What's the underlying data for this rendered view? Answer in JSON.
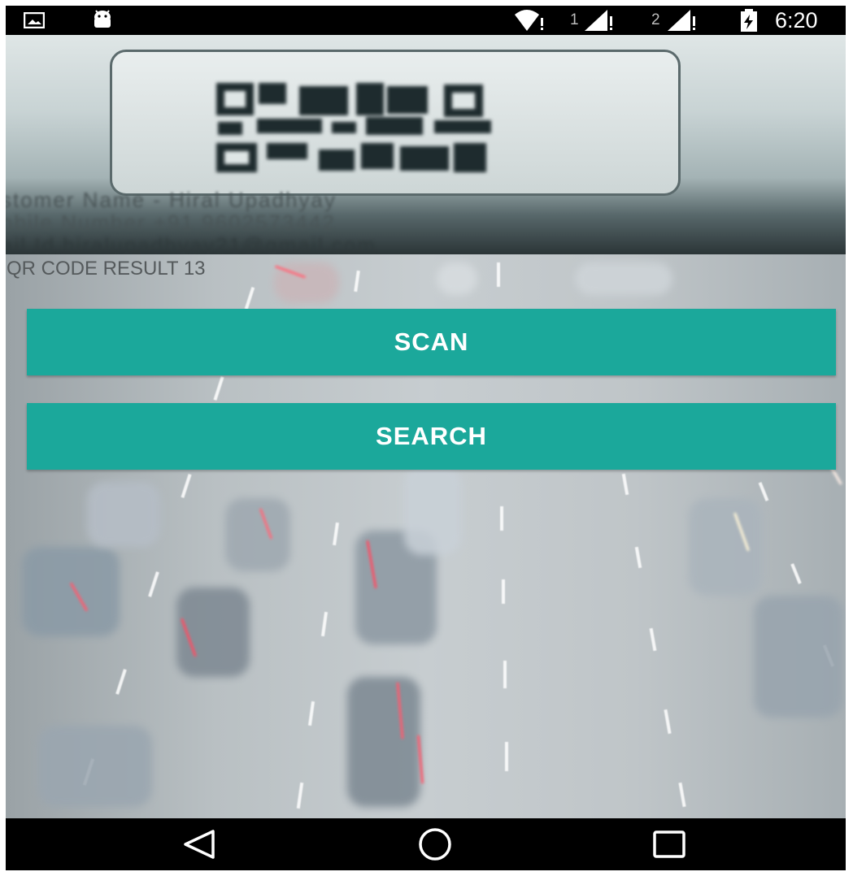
{
  "status_bar": {
    "time": "6:20",
    "sim1_label": "1",
    "sim2_label": "2",
    "icons": [
      "image-notification-icon",
      "android-debug-icon",
      "wifi-icon",
      "signal-icon",
      "signal-icon",
      "battery-charging-icon"
    ]
  },
  "result": {
    "text": "QR CODE RESULT 13"
  },
  "buttons": {
    "scan_label": "SCAN",
    "search_label": "SEARCH"
  },
  "navigation": {
    "icons": [
      "back-icon",
      "home-icon",
      "recents-icon"
    ]
  },
  "colors": {
    "button": "#1ba89b",
    "status_bar": "#000000",
    "nav_bar": "#000000"
  }
}
